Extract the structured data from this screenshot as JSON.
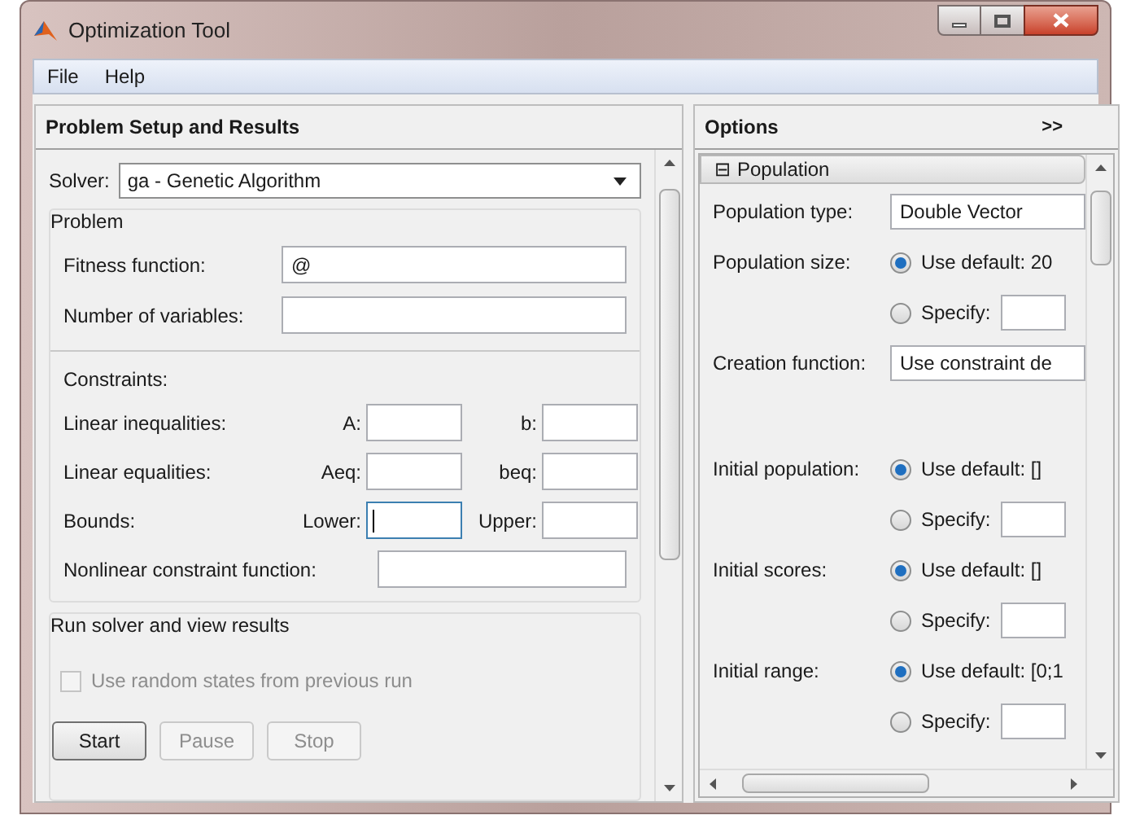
{
  "window": {
    "title": "Optimization Tool"
  },
  "menu": [
    "File",
    "Help"
  ],
  "left": {
    "title": "Problem Setup and Results",
    "solver": {
      "label": "Solver:",
      "value": "ga - Genetic Algorithm"
    },
    "problem": {
      "title": "Problem",
      "fields": [
        {
          "label": "Fitness function:",
          "value": "@"
        },
        {
          "label": "Number of variables:"
        }
      ]
    },
    "constraints": {
      "title": "Constraints:",
      "rows": [
        {
          "label": "Linear inequalities:",
          "fields": [
            {
              "label": "A:",
              "focused": false
            },
            {
              "label": "b:",
              "focused": false
            }
          ]
        },
        {
          "label": "Linear equalities:",
          "fields": [
            {
              "label": "Aeq:",
              "focused": false
            },
            {
              "label": "beq:",
              "focused": false
            }
          ]
        },
        {
          "label": "Bounds:",
          "fields": [
            {
              "label": "Lower:",
              "focused": true
            },
            {
              "label": "Upper:",
              "focused": false
            }
          ]
        }
      ],
      "nonlinear": {
        "label": "Nonlinear constraint function:"
      }
    },
    "run": {
      "title": "Run solver and view results",
      "checkbox": {
        "label": "Use random states from previous run",
        "checked": false,
        "disabled": true
      },
      "buttons": [
        {
          "label": "Start",
          "disabled": false
        },
        {
          "label": "Pause",
          "disabled": true
        },
        {
          "label": "Stop",
          "disabled": true
        }
      ]
    }
  },
  "right": {
    "title": "Options",
    "expand": ">>",
    "section": {
      "symbol": "⊟",
      "title": "Population",
      "expanded": true,
      "rows": [
        {
          "kind": "select",
          "label": "Population type:",
          "value": "Double Vector"
        },
        {
          "kind": "radio",
          "label": "Population size:",
          "options": [
            {
              "kind": "text",
              "label": "Use default: 20",
              "selected": true
            },
            {
              "kind": "field",
              "label": "Specify:",
              "selected": false
            }
          ]
        },
        {
          "kind": "select",
          "label": "Creation function:",
          "value": "Use constraint de"
        },
        {
          "kind": "radio",
          "label": "Initial population:",
          "options": [
            {
              "kind": "text",
              "label": "Use default: []",
              "selected": true
            },
            {
              "kind": "field",
              "label": "Specify:",
              "selected": false
            }
          ]
        },
        {
          "kind": "radio",
          "label": "Initial scores:",
          "options": [
            {
              "kind": "text",
              "label": "Use default: []",
              "selected": true
            },
            {
              "kind": "field",
              "label": "Specify:",
              "selected": false
            }
          ]
        },
        {
          "kind": "radio",
          "label": "Initial range:",
          "options": [
            {
              "kind": "text",
              "label": "Use default: [0;1",
              "selected": true
            },
            {
              "kind": "field",
              "label": "Specify:",
              "selected": false
            }
          ]
        }
      ]
    }
  }
}
